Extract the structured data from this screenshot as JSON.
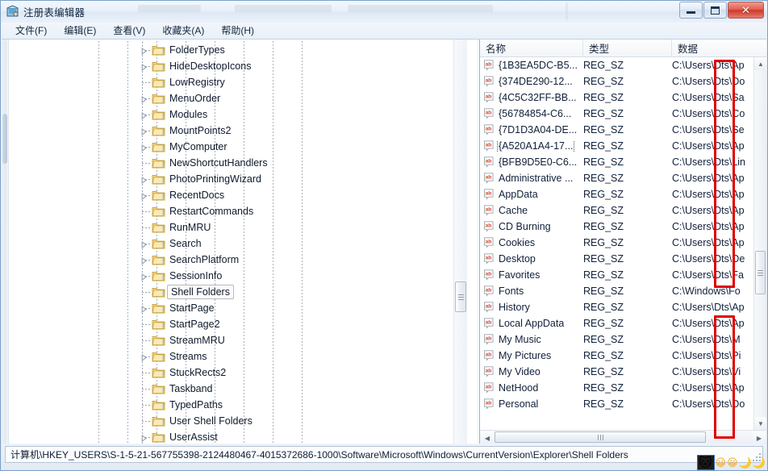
{
  "window": {
    "title": "注册表编辑器",
    "icon": "registry-editor-icon",
    "buttons": {
      "minimize": "最小化",
      "maximize": "最大化",
      "close": "✕"
    }
  },
  "menubar": {
    "items": [
      {
        "name": "file",
        "text": "文件(F)",
        "label": "文件",
        "mnemonic": "F"
      },
      {
        "name": "edit",
        "text": "编辑(E)",
        "label": "编辑",
        "mnemonic": "E"
      },
      {
        "name": "view",
        "text": "查看(V)",
        "label": "查看",
        "mnemonic": "V"
      },
      {
        "name": "favorites",
        "text": "收藏夹(A)",
        "label": "收藏夹",
        "mnemonic": "A"
      },
      {
        "name": "help",
        "text": "帮助(H)",
        "label": "帮助",
        "mnemonic": "H"
      }
    ]
  },
  "tree": {
    "selected": "Shell Folders",
    "nodes": [
      {
        "label": "FolderTypes",
        "expandable": true
      },
      {
        "label": "HideDesktopIcons",
        "expandable": true
      },
      {
        "label": "LowRegistry",
        "expandable": false
      },
      {
        "label": "MenuOrder",
        "expandable": true
      },
      {
        "label": "Modules",
        "expandable": true
      },
      {
        "label": "MountPoints2",
        "expandable": true
      },
      {
        "label": "MyComputer",
        "expandable": true
      },
      {
        "label": "NewShortcutHandlers",
        "expandable": false
      },
      {
        "label": "PhotoPrintingWizard",
        "expandable": true
      },
      {
        "label": "RecentDocs",
        "expandable": true
      },
      {
        "label": "RestartCommands",
        "expandable": false
      },
      {
        "label": "RunMRU",
        "expandable": false
      },
      {
        "label": "Search",
        "expandable": true
      },
      {
        "label": "SearchPlatform",
        "expandable": true
      },
      {
        "label": "SessionInfo",
        "expandable": true
      },
      {
        "label": "Shell Folders",
        "expandable": false,
        "selected": true
      },
      {
        "label": "StartPage",
        "expandable": true
      },
      {
        "label": "StartPage2",
        "expandable": false
      },
      {
        "label": "StreamMRU",
        "expandable": false
      },
      {
        "label": "Streams",
        "expandable": true
      },
      {
        "label": "StuckRects2",
        "expandable": false
      },
      {
        "label": "Taskband",
        "expandable": false
      },
      {
        "label": "TypedPaths",
        "expandable": false
      },
      {
        "label": "User Shell Folders",
        "expandable": false
      },
      {
        "label": "UserAssist",
        "expandable": true
      }
    ]
  },
  "list": {
    "columns": [
      {
        "name": "name",
        "label": "名称"
      },
      {
        "name": "type",
        "label": "类型"
      },
      {
        "name": "data",
        "label": "数据"
      }
    ],
    "rows": [
      {
        "name": "{1B3EA5DC-B5...",
        "type": "REG_SZ",
        "data": "C:\\Users\\Dts\\Ap"
      },
      {
        "name": "{374DE290-12...",
        "type": "REG_SZ",
        "data": "C:\\Users\\Dts\\Do"
      },
      {
        "name": "{4C5C32FF-BB...",
        "type": "REG_SZ",
        "data": "C:\\Users\\Dts\\Sa"
      },
      {
        "name": "{56784854-C6...",
        "type": "REG_SZ",
        "data": "C:\\Users\\Dts\\Co"
      },
      {
        "name": "{7D1D3A04-DE...",
        "type": "REG_SZ",
        "data": "C:\\Users\\Dts\\Se"
      },
      {
        "name": "{A520A1A4-17...",
        "type": "REG_SZ",
        "data": "C:\\Users\\Dts\\Ap",
        "focused": true
      },
      {
        "name": "{BFB9D5E0-C6...",
        "type": "REG_SZ",
        "data": "C:\\Users\\Dts\\Lin"
      },
      {
        "name": "Administrative ...",
        "type": "REG_SZ",
        "data": "C:\\Users\\Dts\\Ap"
      },
      {
        "name": "AppData",
        "type": "REG_SZ",
        "data": "C:\\Users\\Dts\\Ap"
      },
      {
        "name": "Cache",
        "type": "REG_SZ",
        "data": "C:\\Users\\Dts\\Ap"
      },
      {
        "name": "CD Burning",
        "type": "REG_SZ",
        "data": "C:\\Users\\Dts\\Ap"
      },
      {
        "name": "Cookies",
        "type": "REG_SZ",
        "data": "C:\\Users\\Dts\\Ap"
      },
      {
        "name": "Desktop",
        "type": "REG_SZ",
        "data": "C:\\Users\\Dts\\De"
      },
      {
        "name": "Favorites",
        "type": "REG_SZ",
        "data": "C:\\Users\\Dts\\Fa"
      },
      {
        "name": "Fonts",
        "type": "REG_SZ",
        "data": "C:\\Windows\\Fo"
      },
      {
        "name": "History",
        "type": "REG_SZ",
        "data": "C:\\Users\\Dts\\Ap"
      },
      {
        "name": "Local AppData",
        "type": "REG_SZ",
        "data": "C:\\Users\\Dts\\Ap"
      },
      {
        "name": "My Music",
        "type": "REG_SZ",
        "data": "C:\\Users\\Dts\\M"
      },
      {
        "name": "My Pictures",
        "type": "REG_SZ",
        "data": "C:\\Users\\Dts\\Pi"
      },
      {
        "name": "My Video",
        "type": "REG_SZ",
        "data": "C:\\Users\\Dts\\Vi"
      },
      {
        "name": "NetHood",
        "type": "REG_SZ",
        "data": "C:\\Users\\Dts\\Ap"
      },
      {
        "name": "Personal",
        "type": "REG_SZ",
        "data": "C:\\Users\\Dts\\Do"
      }
    ]
  },
  "annotations": {
    "color": "#e00000",
    "boxes": [
      {
        "name": "highlight-dts-upper",
        "target": "Dts folder name in data column, rows 1-14"
      },
      {
        "name": "highlight-dts-lower",
        "target": "Dts folder name in data column, rows 16-22"
      }
    ]
  },
  "statusbar": {
    "path": "计算机\\HKEY_USERS\\S-1-5-21-567755398-2124480467-4015372686-1000\\Software\\Microsoft\\Windows\\CurrentVersion\\Explorer\\Shell Folders"
  },
  "watermark": {
    "tiles": [
      "🐱",
      "😀",
      "😀",
      "🌙",
      "🌙"
    ]
  }
}
